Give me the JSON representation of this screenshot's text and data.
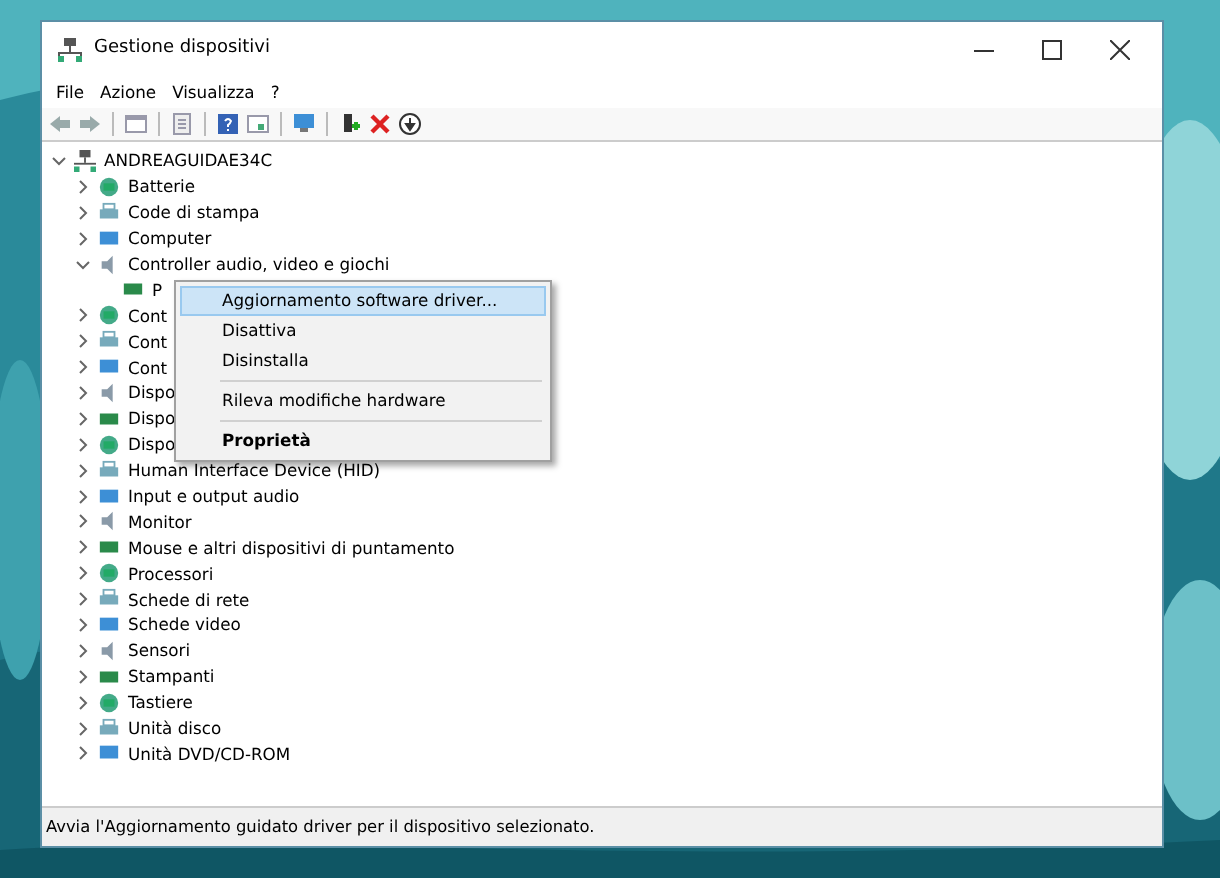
{
  "window": {
    "title": "Gestione dispositivi"
  },
  "menu_bar": [
    "File",
    "Azione",
    "Visualizza",
    "?"
  ],
  "tree": {
    "label": "ANDREAGUIDAE34C",
    "expanded": true,
    "children": [
      {
        "label": "Batterie",
        "expanded": false
      },
      {
        "label": "Code di stampa",
        "expanded": false
      },
      {
        "label": "Computer",
        "expanded": false
      },
      {
        "label": "Controller audio, video e giochi",
        "expanded": true,
        "children": [
          {
            "label": "P"
          }
        ]
      },
      {
        "label": "Cont",
        "expanded": false
      },
      {
        "label": "Cont",
        "expanded": false
      },
      {
        "label": "Cont",
        "expanded": false
      },
      {
        "label": "Dispo",
        "expanded": false
      },
      {
        "label": "Dispo",
        "expanded": false
      },
      {
        "label": "Dispo",
        "expanded": false
      },
      {
        "label": "Human Interface Device (HID)",
        "expanded": false
      },
      {
        "label": "Input e output audio",
        "expanded": false
      },
      {
        "label": "Monitor",
        "expanded": false
      },
      {
        "label": "Mouse e altri dispositivi di puntamento",
        "expanded": false
      },
      {
        "label": "Processori",
        "expanded": false
      },
      {
        "label": "Schede di rete",
        "expanded": false
      },
      {
        "label": "Schede video",
        "expanded": false
      },
      {
        "label": "Sensori",
        "expanded": false
      },
      {
        "label": "Stampanti",
        "expanded": false
      },
      {
        "label": "Tastiere",
        "expanded": false
      },
      {
        "label": "Unità disco",
        "expanded": false
      },
      {
        "label": "Unità DVD/CD-ROM",
        "expanded": false
      }
    ]
  },
  "context_menu": [
    {
      "kind": "item",
      "label": "Aggiornamento software driver...",
      "selected": true,
      "default": false
    },
    {
      "kind": "item",
      "label": "Disattiva",
      "selected": false,
      "default": false
    },
    {
      "kind": "item",
      "label": "Disinstalla",
      "selected": false,
      "default": false
    },
    {
      "kind": "separator"
    },
    {
      "kind": "item",
      "label": "Rileva modifiche hardware",
      "selected": false,
      "default": false
    },
    {
      "kind": "separator"
    },
    {
      "kind": "item",
      "label": "Proprietà",
      "selected": false,
      "default": true
    }
  ],
  "status_bar": "Avvia l'Aggiornamento guidato driver per il dispositivo selezionato."
}
